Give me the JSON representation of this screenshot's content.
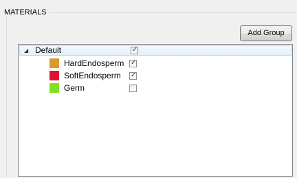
{
  "groupbox": {
    "title": "MATERIALS"
  },
  "toolbar": {
    "add_group_label": "Add Group"
  },
  "tree": {
    "root": {
      "label": "Default",
      "checked": true,
      "expanded": true
    },
    "items": [
      {
        "label": "HardEndosperm",
        "color": "#d99a30",
        "checked": true
      },
      {
        "label": "SoftEndosperm",
        "color": "#e0112d",
        "checked": true
      },
      {
        "label": "Germ",
        "color": "#7fe21c",
        "checked": false
      }
    ]
  }
}
